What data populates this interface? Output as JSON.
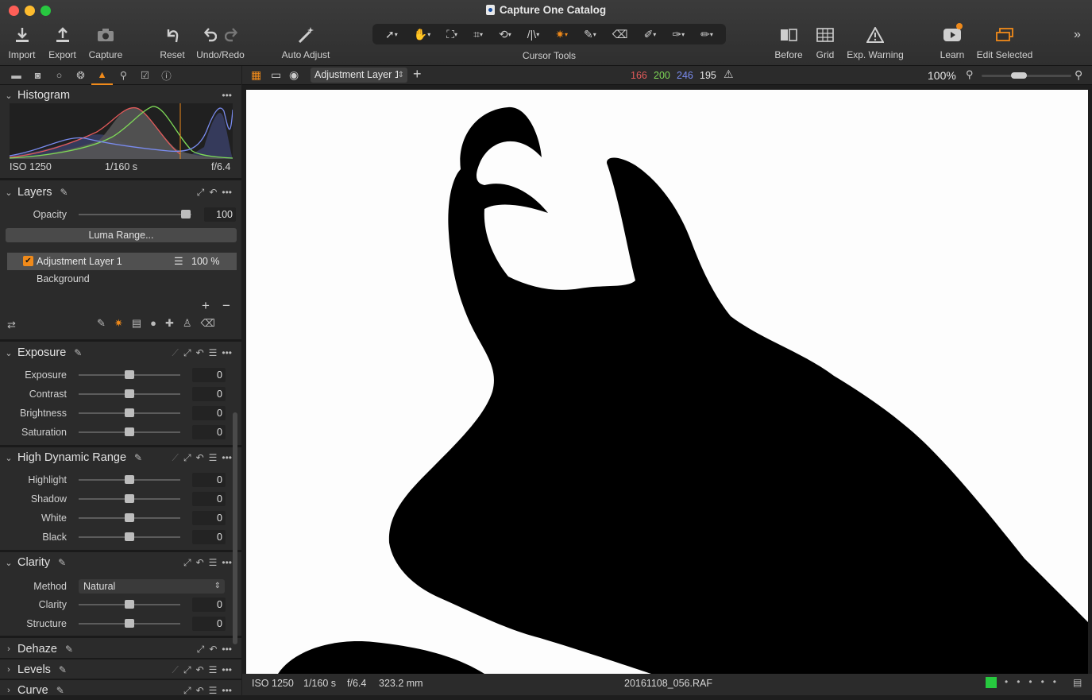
{
  "window": {
    "title": "Capture One Catalog"
  },
  "toolbar": {
    "import": "Import",
    "export": "Export",
    "capture": "Capture",
    "reset": "Reset",
    "undo_redo": "Undo/Redo",
    "auto_adjust": "Auto Adjust",
    "cursor_tools": "Cursor Tools",
    "before": "Before",
    "grid": "Grid",
    "exp_warning": "Exp. Warning",
    "learn": "Learn",
    "edit_selected": "Edit Selected"
  },
  "viewer_bar": {
    "layer_select": "Adjustment Layer 1",
    "rgb": {
      "r": "166",
      "g": "200",
      "b": "246",
      "l": "195"
    },
    "zoom": "100%"
  },
  "histogram": {
    "title": "Histogram",
    "iso": "ISO 1250",
    "shutter": "1/160 s",
    "aperture": "f/6.4"
  },
  "layers": {
    "title": "Layers",
    "opacity_label": "Opacity",
    "opacity_value": "100",
    "opacity_level": 1.0,
    "luma_range": "Luma Range...",
    "items": [
      {
        "name": "Adjustment Layer 1",
        "opacity": "100 %",
        "checked": true
      },
      {
        "name": "Background"
      }
    ]
  },
  "exposure": {
    "title": "Exposure",
    "rows": [
      {
        "label": "Exposure",
        "value": "0",
        "level": 0.5
      },
      {
        "label": "Contrast",
        "value": "0",
        "level": 0.5
      },
      {
        "label": "Brightness",
        "value": "0",
        "level": 0.5
      },
      {
        "label": "Saturation",
        "value": "0",
        "level": 0.5
      }
    ]
  },
  "hdr": {
    "title": "High Dynamic Range",
    "rows": [
      {
        "label": "Highlight",
        "value": "0",
        "level": 0.5
      },
      {
        "label": "Shadow",
        "value": "0",
        "level": 0.5
      },
      {
        "label": "White",
        "value": "0",
        "level": 0.5
      },
      {
        "label": "Black",
        "value": "0",
        "level": 0.5
      }
    ]
  },
  "clarity": {
    "title": "Clarity",
    "method_label": "Method",
    "method_value": "Natural",
    "rows": [
      {
        "label": "Clarity",
        "value": "0",
        "level": 0.5
      },
      {
        "label": "Structure",
        "value": "0",
        "level": 0.5
      }
    ]
  },
  "collapsed": {
    "dehaze": "Dehaze",
    "levels": "Levels",
    "curve": "Curve"
  },
  "status": {
    "iso": "ISO 1250",
    "shutter": "1/160 s",
    "aperture": "f/6.4",
    "focal": "323.2 mm",
    "filename": "20161108_056.RAF"
  },
  "colors": {
    "accent": "#f08a1a",
    "red": "#e25a5a",
    "green": "#7ed957",
    "blue": "#7a8cf0",
    "tag_green": "#27c93f"
  }
}
